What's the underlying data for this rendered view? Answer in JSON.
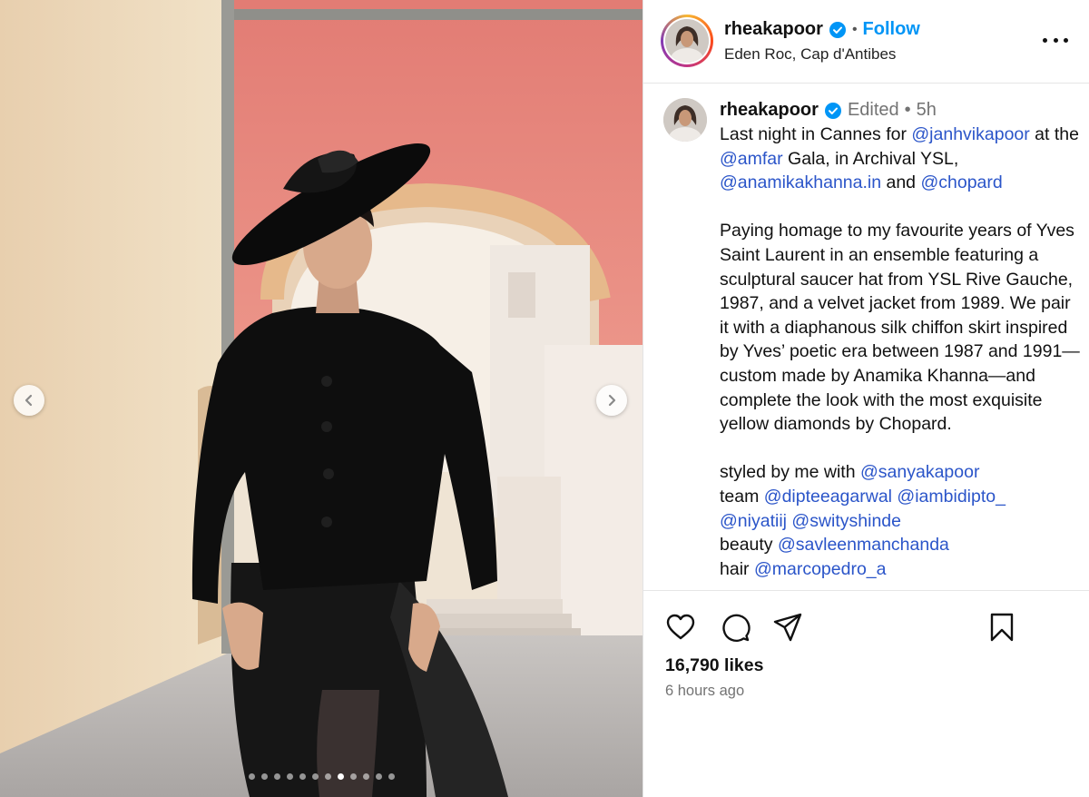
{
  "post": {
    "username": "rheakapoor",
    "follow_label": "Follow",
    "header_separator": "•",
    "location": "Eden Roc, Cap d'Antibes",
    "verified_icon": "verified-badge-icon",
    "more_icon": "more-options-icon"
  },
  "caption": {
    "username": "rheakapoor",
    "edited_label": "Edited",
    "separator": "•",
    "time_ago": "5h",
    "p1": {
      "t1": "Last night in Cannes for ",
      "m1": "@janhvikapoor",
      "t2": " at the ",
      "m2": "@amfar",
      "t3": " Gala, in Archival YSL, ",
      "m3": "@anamikakhanna.in",
      "t4": " and ",
      "m4": "@chopard"
    },
    "p2": "Paying homage to my favourite years of Yves Saint Laurent in an ensemble featuring a sculptural saucer hat from YSL Rive Gauche, 1987, and a velvet jacket from 1989. We pair it with a diaphanous silk chiffon skirt inspired by Yves’ poetic era between 1987 and 1991—custom made by Anamika Khanna—and complete the look with the most exquisite yellow diamonds by Chopard.",
    "credits": {
      "styled_label": "styled by me with ",
      "styled_mention": "@sanyakapoor",
      "team_label": "team ",
      "team_m1": "@dipteeagarwal",
      "team_m2": "@iambidipto_",
      "team_m3": "@niyatiij",
      "team_m4": "@swityshinde",
      "beauty_label": "beauty ",
      "beauty_mention": "@savleenmanchanda",
      "hair_label": "hair ",
      "hair_mention": "@marcopedro_a"
    }
  },
  "actions": {
    "like_icon": "heart-icon",
    "comment_icon": "comment-icon",
    "share_icon": "share-icon",
    "save_icon": "bookmark-icon"
  },
  "likes": "16,790 likes",
  "posted_ago": "6 hours ago",
  "carousel": {
    "prev_icon": "chevron-left-icon",
    "next_icon": "chevron-right-icon",
    "slide_count": 12,
    "active_slide": 8
  },
  "colors": {
    "follow": "#0095f6",
    "mention": "#2b55c9",
    "verified": "#0095f6",
    "muted": "#737373"
  }
}
